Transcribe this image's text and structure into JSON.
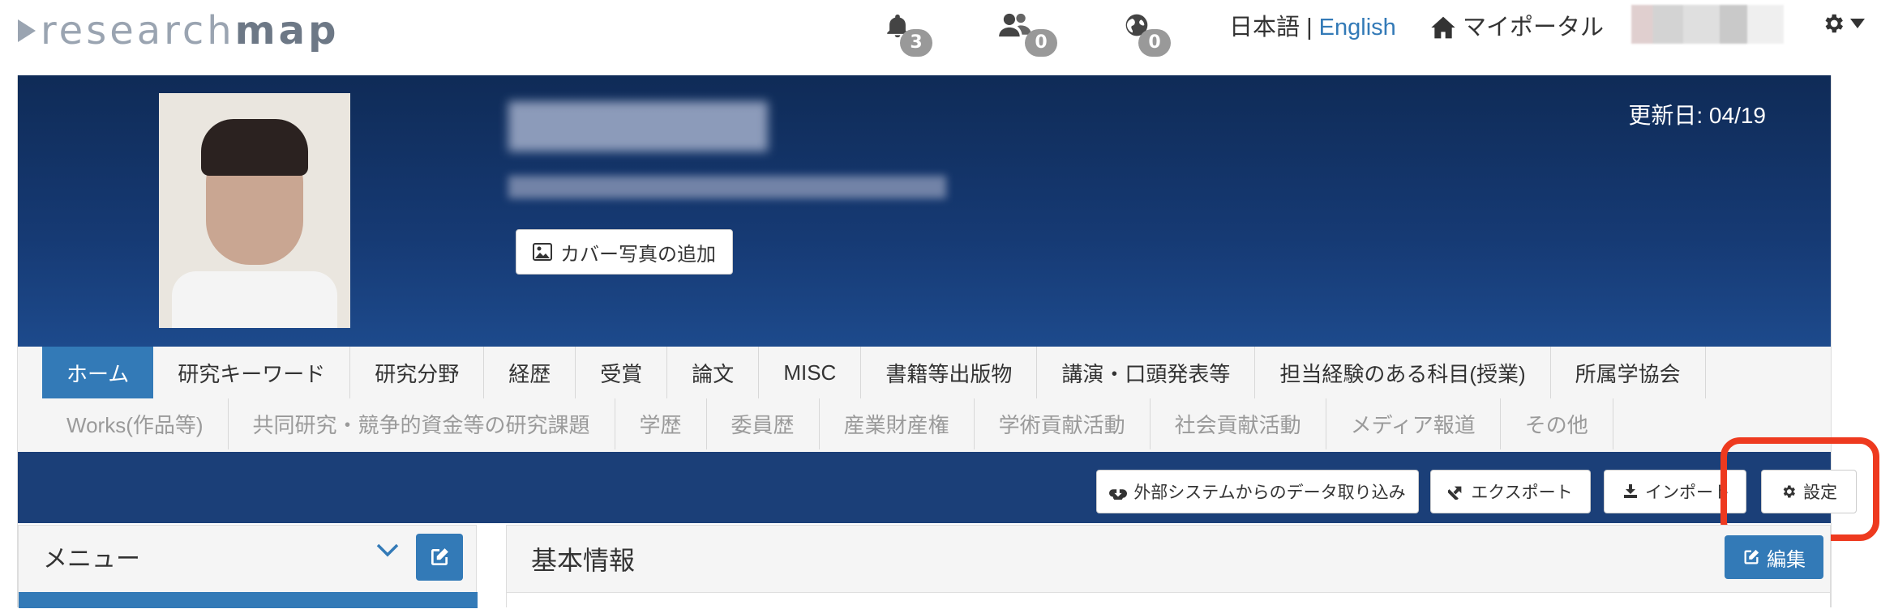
{
  "logo": {
    "light": "research",
    "bold": "map"
  },
  "nav": {
    "notifications": {
      "icon": "bell-icon",
      "count": "3"
    },
    "friends": {
      "icon": "users-icon",
      "count": "0"
    },
    "global": {
      "icon": "globe-icon",
      "count": "0"
    },
    "lang_ja": "日本語",
    "lang_sep": " | ",
    "lang_en": "English",
    "portal": "マイポータル"
  },
  "profile": {
    "updated": "更新日: 04/19",
    "cover_button": "カバー写真の追加"
  },
  "tabs": {
    "row1": [
      "ホーム",
      "研究キーワード",
      "研究分野",
      "経歴",
      "受賞",
      "論文",
      "MISC",
      "書籍等出版物",
      "講演・口頭発表等",
      "担当経験のある科目(授業)",
      "所属学協会"
    ],
    "row2": [
      "Works(作品等)",
      "共同研究・競争的資金等の研究課題",
      "学歴",
      "委員歴",
      "産業財産権",
      "学術貢献活動",
      "社会貢献活動",
      "メディア報道",
      "その他"
    ]
  },
  "actions": {
    "import_external": "外部システムからのデータ取り込み",
    "export": "エクスポート",
    "import": "インポート",
    "settings": "設定"
  },
  "menu": {
    "title": "メニュー"
  },
  "basic": {
    "title": "基本情報",
    "edit": "編集"
  },
  "colors": {
    "accent": "#337ab7",
    "banner": "#163a74",
    "highlight": "#ee3a1f"
  }
}
